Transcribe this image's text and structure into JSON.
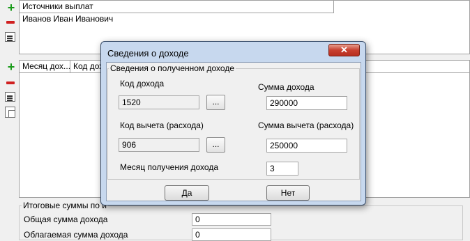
{
  "sources": {
    "header": "Источники выплат",
    "rows": [
      "Иванов Иван Иванович"
    ]
  },
  "income_list": {
    "columns": [
      "Месяц дох...",
      "Код дохо"
    ]
  },
  "totals": {
    "group_label": "Итоговые суммы по и",
    "total_income_label": "Общая сумма дохода",
    "total_income_value": "0",
    "taxable_label": "Облагаемая сумма дохода",
    "taxable_value": "0"
  },
  "dialog": {
    "title": "Сведения о доходе",
    "close_label": "✕",
    "group_label": "Сведения о полученном доходе",
    "income_code_label": "Код дохода",
    "income_code_value": "1520",
    "dots_label": "...",
    "income_sum_label": "Сумма дохода",
    "income_sum_value": "290000",
    "deduction_code_label": "Код вычета (расхода)",
    "deduction_code_value": "906",
    "deduction_sum_label": "Сумма вычета (расхода)",
    "deduction_sum_value": "250000",
    "month_label": "Месяц получения дохода",
    "month_value": "3",
    "ok_label": "Да",
    "cancel_label": "Нет"
  }
}
